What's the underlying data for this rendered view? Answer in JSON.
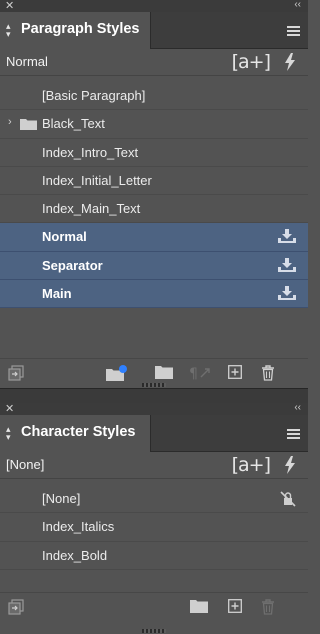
{
  "paragraph_panel": {
    "title": "Paragraph Styles",
    "current_style": "Normal",
    "styles": [
      {
        "label": "[Basic Paragraph]",
        "selected": false,
        "group": false
      },
      {
        "label": "Black_Text",
        "selected": false,
        "group": true
      },
      {
        "label": "Index_Intro_Text",
        "selected": false,
        "group": false
      },
      {
        "label": "Index_Initial_Letter",
        "selected": false,
        "group": false
      },
      {
        "label": "Index_Main_Text",
        "selected": false,
        "group": false
      },
      {
        "label": "Normal",
        "selected": true,
        "group": false,
        "icon": "import-icon"
      },
      {
        "label": "Separator",
        "selected": true,
        "group": false,
        "icon": "import-icon"
      },
      {
        "label": "Main",
        "selected": true,
        "group": false,
        "icon": "import-icon"
      }
    ],
    "quick_apply_label": "[a+]"
  },
  "character_panel": {
    "title": "Character Styles",
    "current_style": "[None]",
    "styles": [
      {
        "label": "[None]",
        "selected": false,
        "icon": "lock-slash-icon"
      },
      {
        "label": "Index_Italics",
        "selected": false
      },
      {
        "label": "Index_Bold",
        "selected": false
      }
    ],
    "quick_apply_label": "[a+]"
  },
  "colors": {
    "panel_bg": "#535353",
    "selection": "#4d6382",
    "tab_bar": "#3d3d3d"
  }
}
